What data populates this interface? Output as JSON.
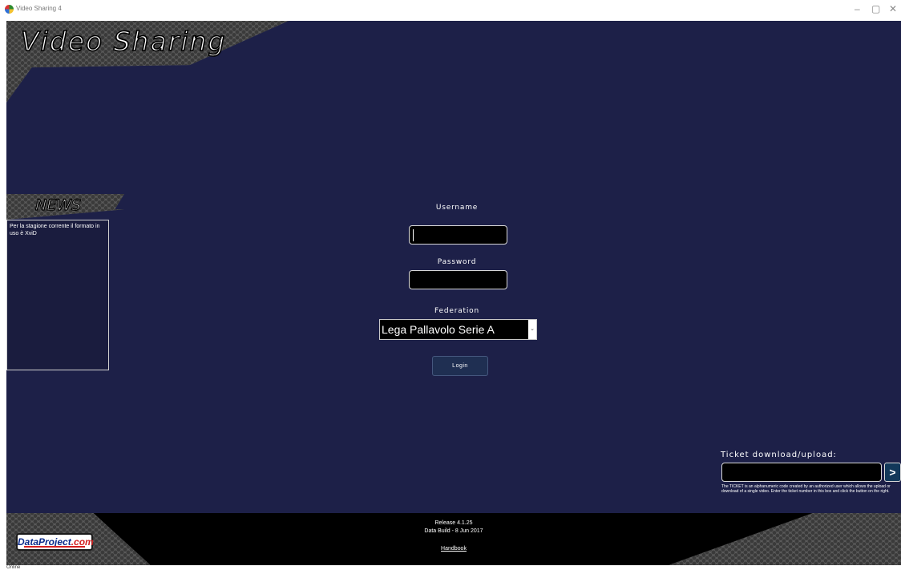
{
  "window": {
    "title": "Video Sharing 4",
    "minimize_glyph": "–",
    "restore_glyph": "▢",
    "close_glyph": "✕",
    "app_icon": "app-globe-icon"
  },
  "header": {
    "logo_text": "Video Sharing"
  },
  "news": {
    "title": "NEWS",
    "text": "Per la stagione corrente il formato in uso è XviD"
  },
  "login": {
    "username_label": "Username",
    "username_value": "",
    "password_label": "Password",
    "password_value": "",
    "federation_label": "Federation",
    "federation_value": "Lega Pallavolo Serie A",
    "dropdown_glyph": "⌄",
    "login_label": "Login"
  },
  "ticket": {
    "label": "Ticket download/upload:",
    "value": "",
    "go_label": ">",
    "help": "The TICKET is an alphanumeric code created by an authorized user which allows the upload or download of a single video. Enter the ticket number in this box and click the button on the right."
  },
  "footer": {
    "logo_main": "DataProject",
    "logo_suffix": ".com",
    "release": "Release 4.1.25",
    "data_build": "Data Build - 8 Jun 2017",
    "handbook": "Handbook"
  },
  "status": {
    "text": "Online"
  },
  "colors": {
    "background": "#1d2048",
    "panel": "#1a1c3e",
    "button": "#1f2f52",
    "footer": "#000000"
  }
}
